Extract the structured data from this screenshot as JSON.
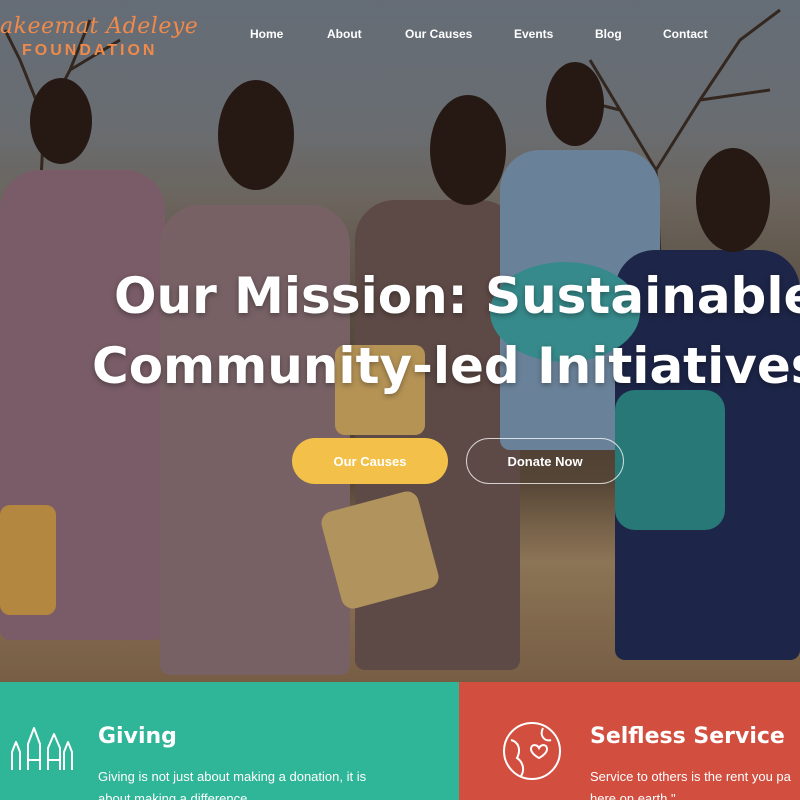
{
  "brand": {
    "name_script": "akeemat Adeleye",
    "name_sub": "FOUNDATION",
    "color": "#f08a4b"
  },
  "nav": {
    "items": [
      "Home",
      "About",
      "Our Causes",
      "Events",
      "Blog",
      "Contact"
    ]
  },
  "hero": {
    "headline_line1": "Our Mission: Sustainable",
    "headline_line2": "Community-led Initiatives",
    "primary_button": "Our Causes",
    "secondary_button": "Donate Now",
    "primary_color": "#f3c14a"
  },
  "features": [
    {
      "title": "Giving",
      "text_line1": "Giving is not just about making a donation, it is",
      "text_line2": "about making a difference",
      "icon": "raised-hands-icon",
      "color": "#2fb597"
    },
    {
      "title": "Selfless Service",
      "text_line1": "Service to others is the rent you pa",
      "text_line2": "here on earth.\"",
      "icon": "globe-heart-icon",
      "color": "#d24e3f"
    }
  ]
}
